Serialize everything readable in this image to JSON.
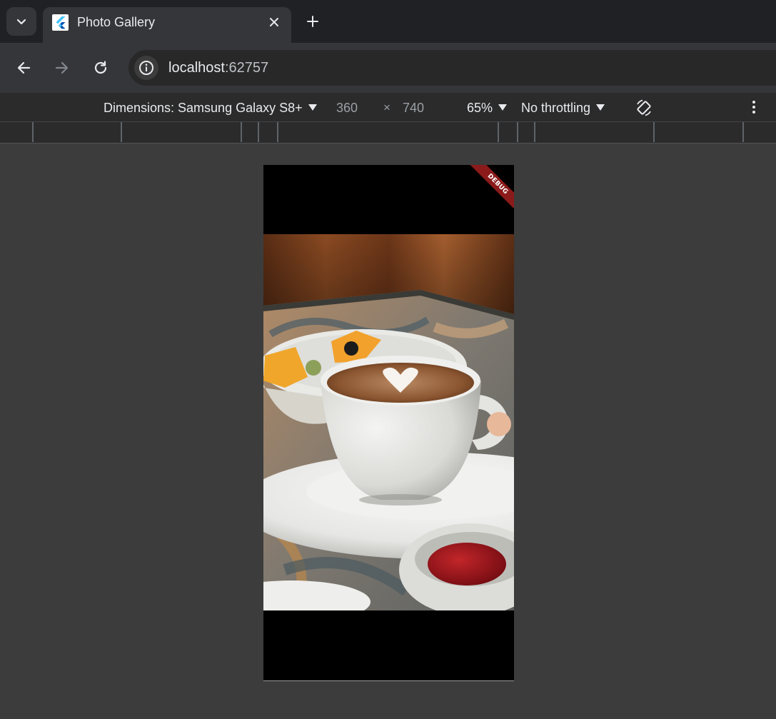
{
  "browser": {
    "tab": {
      "title": "Photo Gallery"
    },
    "address_bar": {
      "host": "localhost",
      "port": ":62757"
    }
  },
  "device_toolbar": {
    "dimensions_label": "Dimensions: Samsung Galaxy S8+",
    "width": "360",
    "times": "×",
    "height": "740",
    "zoom": "65%",
    "throttling": "No throttling"
  },
  "app": {
    "debug_banner": "DEBUG",
    "photo": {
      "subject": "cappuccino with latte-art heart, fruit bowl and jam on a patterned table"
    }
  },
  "colors": {
    "background": "#3c3c3c",
    "tabstrip": "#202124",
    "toolbar": "#35363a",
    "debug_ribbon": "#8b1a1a"
  },
  "icons": {
    "tab_search": "chevron-down-icon",
    "favicon": "flutter-icon",
    "tab_close": "close-icon",
    "new_tab": "plus-icon",
    "back": "arrow-left-icon",
    "forward": "arrow-right-icon",
    "reload": "reload-icon",
    "site_info": "info-icon",
    "rotate": "rotate-icon",
    "more": "more-vertical-icon"
  }
}
